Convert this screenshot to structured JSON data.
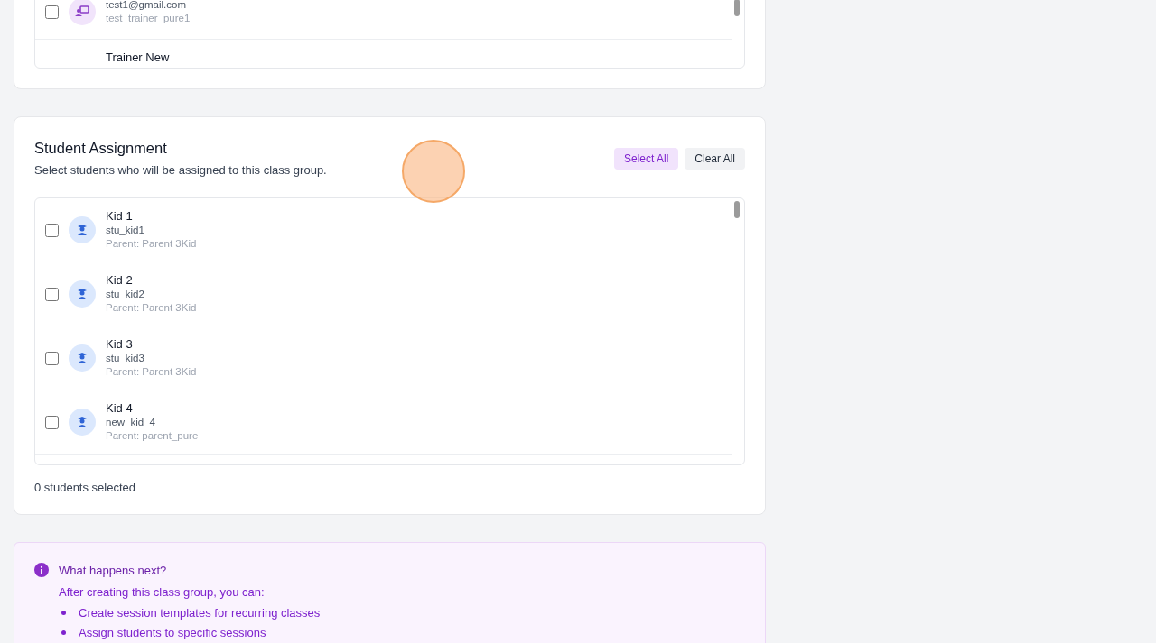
{
  "trainer_list": [
    {
      "email": "test1@gmail.com",
      "username": "test_trainer_pure1",
      "checked": false
    },
    {
      "name": "Trainer New"
    }
  ],
  "student_assignment": {
    "title": "Student Assignment",
    "description": "Select students who will be assigned to this class group.",
    "buttons": [
      {
        "label": "Select All",
        "kind": "primary"
      },
      {
        "label": "Clear All",
        "kind": "secondary"
      }
    ],
    "students": [
      {
        "name": "Kid 1",
        "username": "stu_kid1",
        "parent": "Parent: Parent 3Kid",
        "checked": false
      },
      {
        "name": "Kid 2",
        "username": "stu_kid2",
        "parent": "Parent: Parent 3Kid",
        "checked": false
      },
      {
        "name": "Kid 3",
        "username": "stu_kid3",
        "parent": "Parent: Parent 3Kid",
        "checked": false
      },
      {
        "name": "Kid 4",
        "username": "new_kid_4",
        "parent": "Parent: parent_pure",
        "checked": false
      }
    ],
    "selected_count": "0 students selected"
  },
  "info": {
    "title": "What happens next?",
    "intro": "After creating this class group, you can:",
    "items": [
      "Create session templates for recurring classes",
      "Assign students to specific sessions"
    ]
  }
}
